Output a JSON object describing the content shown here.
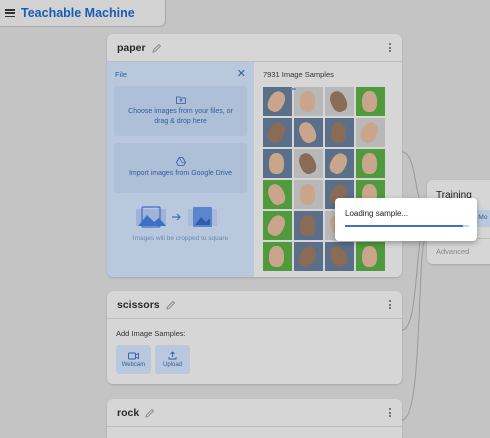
{
  "app": {
    "title": "Teachable Machine"
  },
  "classes": [
    {
      "name": "paper",
      "file_panel": {
        "label": "File",
        "upload_text": "Choose images from your files, or drag & drop here",
        "drive_text": "Import images from Google Drive",
        "crop_note": "Images will be cropped to square"
      },
      "samples_count": "7931 Image Samples"
    },
    {
      "name": "scissors",
      "add_samples_label": "Add Image Samples:",
      "webcam_label": "Webcam",
      "upload_label": "Upload"
    },
    {
      "name": "rock"
    }
  ],
  "training": {
    "title": "Training",
    "button_label": "n Mo",
    "advanced_label": "Advanced"
  },
  "loading": {
    "text": "Loading sample...",
    "progress": 0.95
  },
  "colors": {
    "brand": "#1a5bb3",
    "accent": "#3d72c9",
    "grid_green": "#4f9a3c"
  },
  "thumbnails": [
    "b",
    "w",
    "w",
    "g",
    "b",
    "b",
    "b",
    "w",
    "b",
    "w",
    "b",
    "g",
    "g",
    "w",
    "b",
    "g",
    "g",
    "b",
    "w",
    "g",
    "g",
    "b",
    "b",
    "g"
  ]
}
